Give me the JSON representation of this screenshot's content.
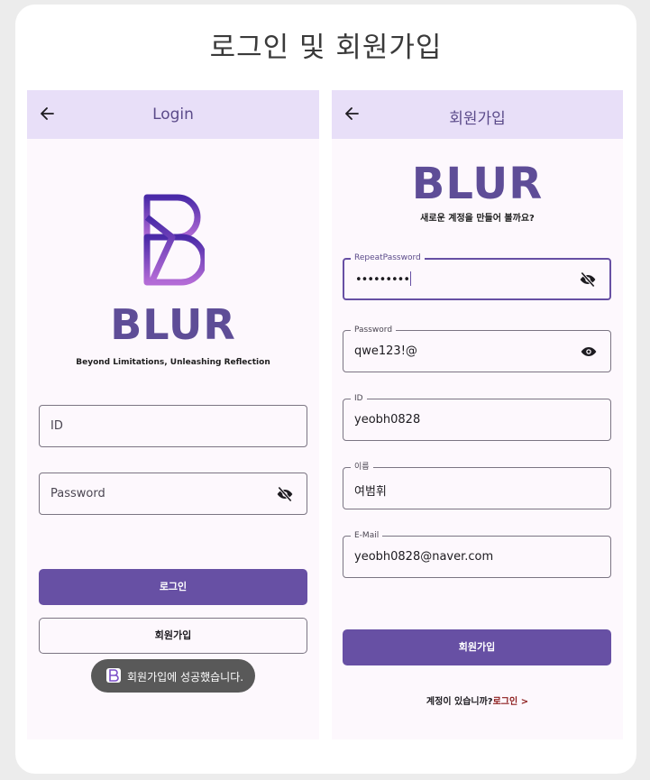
{
  "page": {
    "title": "로그인 및 회원가입"
  },
  "login": {
    "appbar": {
      "title": "Login"
    },
    "brand": {
      "word": "BLUR",
      "tagline": "Beyond Limitations, Unleashing Reflection"
    },
    "id_field": {
      "placeholder": "ID"
    },
    "password_field": {
      "placeholder": "Password"
    },
    "login_button": "로그인",
    "signup_button": "회원가입",
    "toast": "회원가입에 성공했습니다."
  },
  "signup": {
    "appbar": {
      "title": "회원가입"
    },
    "brand": {
      "word": "BLUR",
      "subtitle": "새로운 계정을 만들어 볼까요?"
    },
    "fields": {
      "repeat_password": {
        "label": "RepeatPassword",
        "value": "•••••••••"
      },
      "password": {
        "label": "Password",
        "value": "qwe123!@"
      },
      "id": {
        "label": "ID",
        "value": "yeobh0828"
      },
      "name": {
        "label": "이름",
        "value": "여범휘"
      },
      "email": {
        "label": "E-Mail",
        "value": "yeobh0828@naver.com"
      }
    },
    "submit_button": "회원가입",
    "have_account": {
      "question": "계정이 있습니까?",
      "link": "로그인 >"
    }
  },
  "colors": {
    "primary": "#6750a4",
    "appbar": "#e8dff8",
    "brand_text": "#5e4d97",
    "link": "#8b1a1a"
  }
}
